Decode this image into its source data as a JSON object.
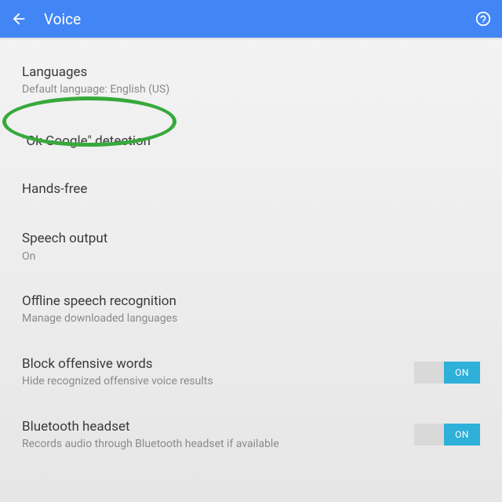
{
  "appbar": {
    "title": "Voice"
  },
  "items": {
    "languages": {
      "title": "Languages",
      "sub": "Default language: English (US)"
    },
    "okgoogle": {
      "title": "\"Ok Google\" detection"
    },
    "handsfree": {
      "title": "Hands-free"
    },
    "speech": {
      "title": "Speech output",
      "sub": "On"
    },
    "offline": {
      "title": "Offline speech recognition",
      "sub": "Manage downloaded languages"
    },
    "block": {
      "title": "Block offensive words",
      "sub": "Hide recognized offensive voice results",
      "toggle": "ON"
    },
    "bluetooth": {
      "title": "Bluetooth headset",
      "sub": "Records audio through Bluetooth headset if available",
      "toggle": "ON"
    }
  }
}
